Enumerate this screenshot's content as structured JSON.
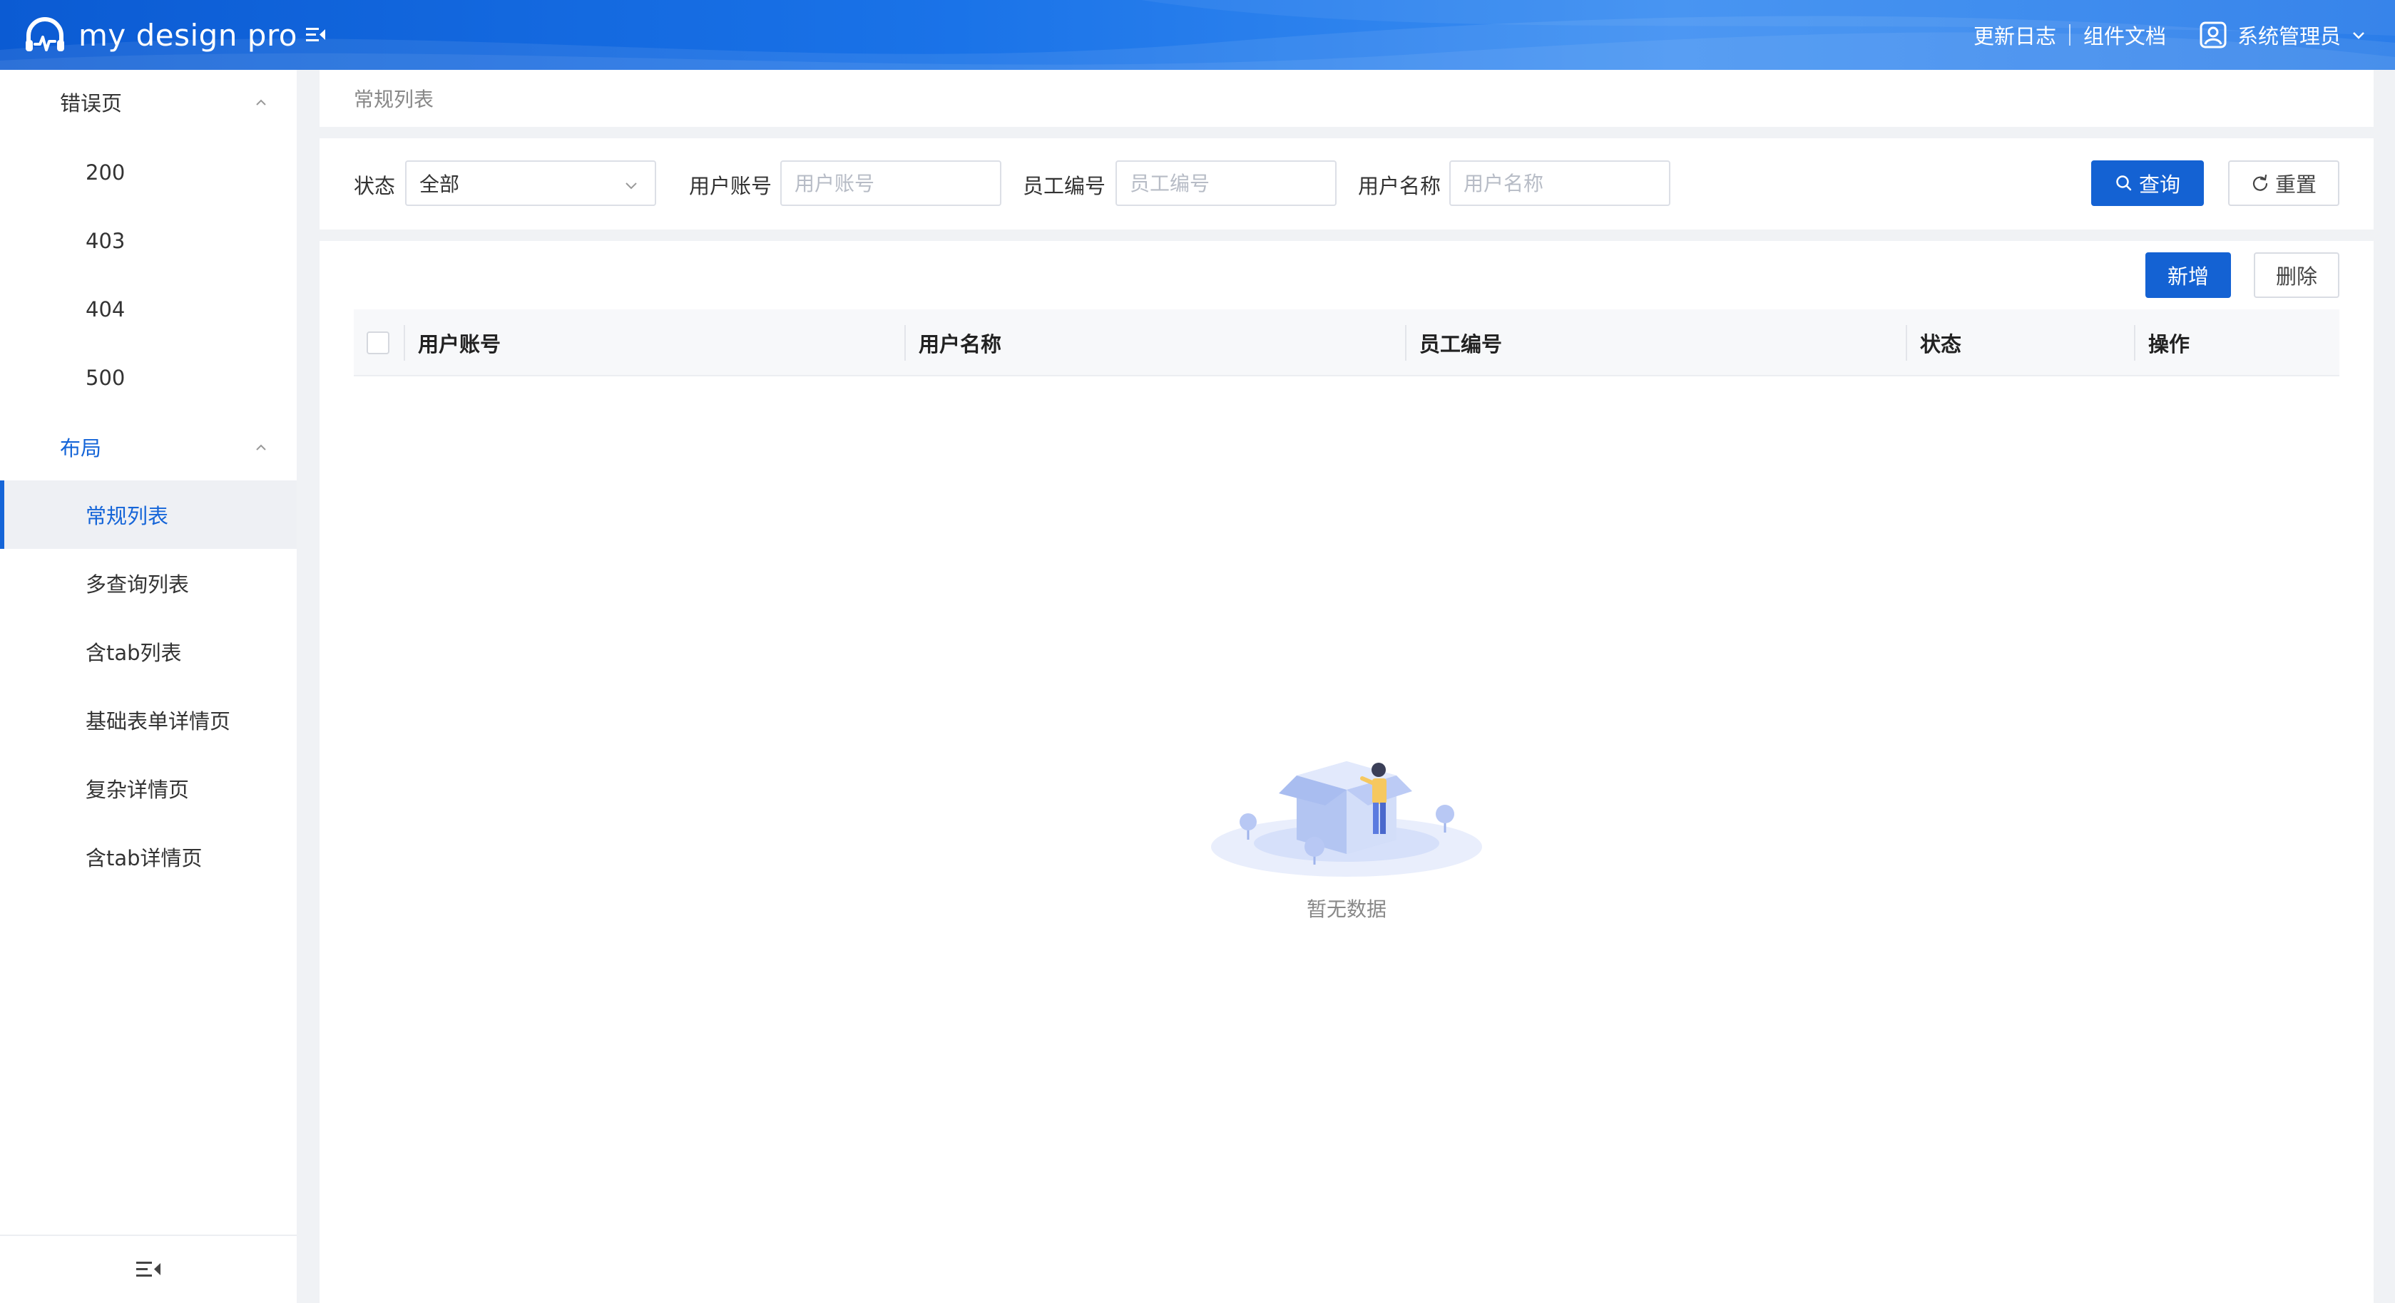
{
  "app": {
    "title": "my design pro"
  },
  "header": {
    "links": [
      "更新日志",
      "组件文档"
    ],
    "user_name": "系统管理员"
  },
  "sidebar": {
    "groups": [
      {
        "label": "错误页",
        "items": [
          "200",
          "403",
          "404",
          "500"
        ]
      },
      {
        "label": "布局",
        "items": [
          "常规列表",
          "多查询列表",
          "含tab列表",
          "基础表单详情页",
          "复杂详情页",
          "含tab详情页"
        ]
      }
    ],
    "active_item": "常规列表"
  },
  "breadcrumb": {
    "current": "常规列表"
  },
  "search": {
    "status_label": "状态",
    "status_value": "全部",
    "account_label": "用户账号",
    "account_placeholder": "用户账号",
    "employee_label": "员工编号",
    "employee_placeholder": "员工编号",
    "name_label": "用户名称",
    "name_placeholder": "用户名称",
    "query_button": "查询",
    "reset_button": "重置"
  },
  "table": {
    "add_button": "新增",
    "delete_button": "删除",
    "columns": [
      "用户账号",
      "用户名称",
      "员工编号",
      "状态",
      "操作"
    ],
    "rows": [],
    "empty_text": "暂无数据"
  },
  "colors": {
    "primary": "#1462d3",
    "active_text": "#1565d8",
    "header_gradient_start": "#0b5bd3",
    "header_gradient_end": "#3d8ff2"
  }
}
